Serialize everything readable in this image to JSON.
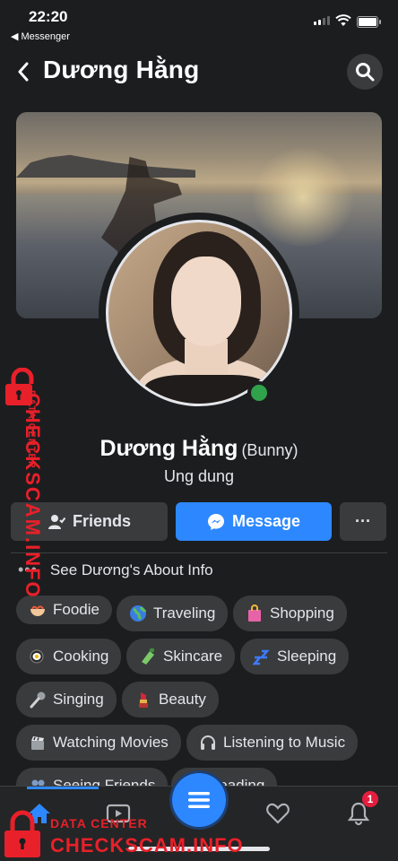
{
  "status_bar": {
    "time": "22:20",
    "back_app": "◀ Messenger"
  },
  "header": {
    "title": "Dương Hằng"
  },
  "profile": {
    "name": "Dương Hằng",
    "nickname": "(Bunny)",
    "bio": "Ung dung",
    "online": true
  },
  "actions": {
    "friends_label": "Friends",
    "message_label": "Message",
    "more_label": "···"
  },
  "about": {
    "dots": "•••",
    "label": "See Dương's About Info"
  },
  "interests": [
    {
      "label": "Foodie",
      "icon": "bowl-icon"
    },
    {
      "label": "Traveling",
      "icon": "globe-icon"
    },
    {
      "label": "Shopping",
      "icon": "shopping-bag-icon"
    },
    {
      "label": "Cooking",
      "icon": "frying-pan-icon"
    },
    {
      "label": "Skincare",
      "icon": "lotion-icon"
    },
    {
      "label": "Sleeping",
      "icon": "zzz-icon"
    },
    {
      "label": "Singing",
      "icon": "microphone-icon"
    },
    {
      "label": "Beauty",
      "icon": "lipstick-icon"
    },
    {
      "label": "Watching Movies",
      "icon": "clapperboard-icon"
    },
    {
      "label": "Listening to Music",
      "icon": "headphones-icon"
    },
    {
      "label": "Seeing Friends",
      "icon": "people-icon"
    },
    {
      "label": "Reading",
      "icon": "book-icon"
    }
  ],
  "tabbar": {
    "notification_count": "1",
    "active_tab": "home"
  },
  "watermark": {
    "line1": "DATA CENTER",
    "line2": "CHECKSCAM.INFO"
  },
  "colors": {
    "accent": "#2d88ff",
    "online": "#31a24c",
    "badge": "#e41e3f",
    "watermark": "#e8202a"
  }
}
